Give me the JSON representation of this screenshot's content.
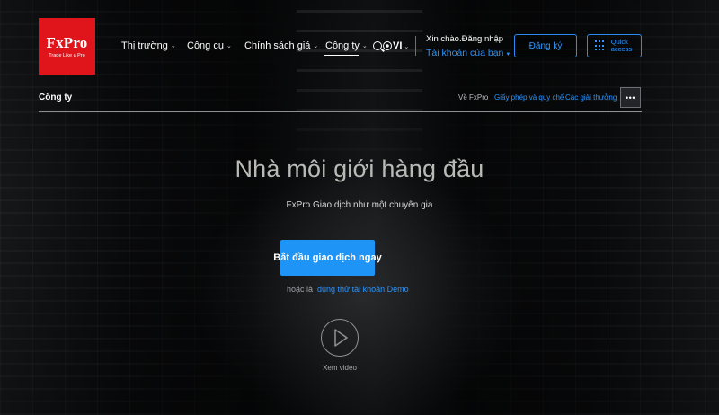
{
  "brand": {
    "name": "FxPro",
    "tagline": "Trade Like a Pro",
    "color": "#e0141b"
  },
  "nav": {
    "items": [
      {
        "label": "Thị trường"
      },
      {
        "label": "Công cụ"
      },
      {
        "label": "Chính sách giá"
      },
      {
        "label": "Công ty",
        "active": true
      }
    ],
    "language": "VI"
  },
  "account": {
    "greeting": "Xin chào.Đăng nhập",
    "link": "Tài khoản của bạn",
    "register_label": "Đăng ký",
    "quick_access_label": "Quick access"
  },
  "subnav": {
    "section_title": "Công ty",
    "links": [
      "Về FxPro",
      "Giấy phép và quy chế",
      "Các giải thưởng"
    ],
    "more_label": "•••"
  },
  "hero": {
    "title": "Nhà môi giới hàng đầu",
    "subtitle": "FxPro Giao dịch như một chuyên gia",
    "cta_label": "Bắt đầu giao dịch ngay",
    "or_text": "hoặc là",
    "demo_link": "dùng thử tài khoản Demo",
    "video_label": "Xem video"
  },
  "colors": {
    "accent": "#1d94f6",
    "link": "#2a94ff"
  },
  "icons": [
    "search-icon",
    "globe-icon",
    "grid-icon",
    "play-icon",
    "chevron-down-icon"
  ]
}
